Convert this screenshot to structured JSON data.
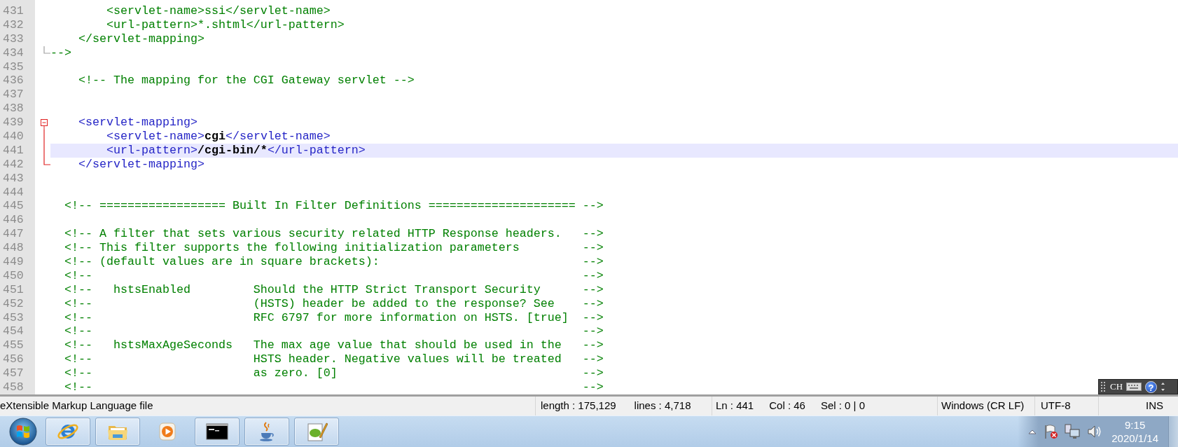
{
  "editor": {
    "lines": [
      {
        "number": "431",
        "kind": "plain",
        "current": false,
        "segments": [
          {
            "kind": "comment",
            "text": "        <servlet-name>ssi</servlet-name>"
          }
        ]
      },
      {
        "number": "432",
        "kind": "plain",
        "current": false,
        "segments": [
          {
            "kind": "comment",
            "text": "        <url-pattern>*.shtml</url-pattern>"
          }
        ]
      },
      {
        "number": "433",
        "kind": "plain",
        "current": false,
        "segments": [
          {
            "kind": "comment",
            "text": "    </servlet-mapping>"
          }
        ]
      },
      {
        "number": "434",
        "kind": "fold_end",
        "current": false,
        "fold_active": false,
        "segments": [
          {
            "kind": "comment",
            "text": "-->"
          }
        ]
      },
      {
        "number": "435",
        "kind": "plain",
        "current": false
      },
      {
        "number": "436",
        "kind": "plain",
        "current": false,
        "segments": [
          {
            "kind": "comment",
            "text": "    <!-- The mapping for the CGI Gateway servlet -->"
          }
        ]
      },
      {
        "number": "437",
        "kind": "plain",
        "current": false
      },
      {
        "number": "438",
        "kind": "plain",
        "current": false
      },
      {
        "number": "439",
        "kind": "fold_start",
        "current": false,
        "fold_active": true,
        "segments": [
          {
            "kind": "tag",
            "text": "    <servlet-mapping>"
          }
        ]
      },
      {
        "number": "440",
        "kind": "fold_line",
        "current": false,
        "fold_active": true,
        "segments": [
          {
            "kind": "tag",
            "text": "        <servlet-name>"
          },
          {
            "kind": "text",
            "text": "cgi"
          },
          {
            "kind": "tag",
            "text": "</servlet-name>"
          }
        ]
      },
      {
        "number": "441",
        "kind": "fold_line",
        "current": true,
        "fold_active": true,
        "segments": [
          {
            "kind": "tag",
            "text": "        <url-pattern>"
          },
          {
            "kind": "text",
            "text": "/cgi-bin/*"
          },
          {
            "kind": "tag",
            "text": "</url-pattern>"
          }
        ]
      },
      {
        "number": "442",
        "kind": "fold_end",
        "current": false,
        "fold_active": true,
        "segments": [
          {
            "kind": "tag",
            "text": "    </servlet-mapping>"
          }
        ]
      },
      {
        "number": "443",
        "kind": "plain",
        "current": false
      },
      {
        "number": "444",
        "kind": "plain",
        "current": false
      },
      {
        "number": "445",
        "kind": "plain",
        "current": false,
        "segments": [
          {
            "kind": "comment",
            "text": "  <!-- ================== Built In Filter Definitions ===================== -->"
          }
        ]
      },
      {
        "number": "446",
        "kind": "plain",
        "current": false
      },
      {
        "number": "447",
        "kind": "plain",
        "current": false,
        "segments": [
          {
            "kind": "comment",
            "text": "  <!-- A filter that sets various security related HTTP Response headers.   -->"
          }
        ]
      },
      {
        "number": "448",
        "kind": "plain",
        "current": false,
        "segments": [
          {
            "kind": "comment",
            "text": "  <!-- This filter supports the following initialization parameters         -->"
          }
        ]
      },
      {
        "number": "449",
        "kind": "plain",
        "current": false,
        "segments": [
          {
            "kind": "comment",
            "text": "  <!-- (default values are in square brackets):                             -->"
          }
        ]
      },
      {
        "number": "450",
        "kind": "plain",
        "current": false,
        "segments": [
          {
            "kind": "comment",
            "text": "  <!--                                                                      -->"
          }
        ]
      },
      {
        "number": "451",
        "kind": "plain",
        "current": false,
        "segments": [
          {
            "kind": "comment",
            "text": "  <!--   hstsEnabled         Should the HTTP Strict Transport Security      -->"
          }
        ]
      },
      {
        "number": "452",
        "kind": "plain",
        "current": false,
        "segments": [
          {
            "kind": "comment",
            "text": "  <!--                       (HSTS) header be added to the response? See    -->"
          }
        ]
      },
      {
        "number": "453",
        "kind": "plain",
        "current": false,
        "segments": [
          {
            "kind": "comment",
            "text": "  <!--                       RFC 6797 for more information on HSTS. [true]  -->"
          }
        ]
      },
      {
        "number": "454",
        "kind": "plain",
        "current": false,
        "segments": [
          {
            "kind": "comment",
            "text": "  <!--                                                                      -->"
          }
        ]
      },
      {
        "number": "455",
        "kind": "plain",
        "current": false,
        "segments": [
          {
            "kind": "comment",
            "text": "  <!--   hstsMaxAgeSeconds   The max age value that should be used in the   -->"
          }
        ]
      },
      {
        "number": "456",
        "kind": "plain",
        "current": false,
        "segments": [
          {
            "kind": "comment",
            "text": "  <!--                       HSTS header. Negative values will be treated   -->"
          }
        ]
      },
      {
        "number": "457",
        "kind": "plain",
        "current": false,
        "segments": [
          {
            "kind": "comment",
            "text": "  <!--                       as zero. [0]                                   -->"
          }
        ]
      },
      {
        "number": "458",
        "kind": "plain",
        "current": false,
        "segments": [
          {
            "kind": "comment",
            "text": "  <!--                                                                      -->"
          }
        ]
      }
    ]
  },
  "language_bar": {
    "label": "CH",
    "help": "?"
  },
  "status_bar": {
    "file_type": "eXtensible Markup Language file",
    "length": "length : 175,129",
    "lines": "lines : 4,718",
    "ln": "Ln : 441",
    "col": "Col : 46",
    "sel": "Sel : 0 | 0",
    "eol": "Windows (CR LF)",
    "encoding": "UTF-8",
    "mode": "INS"
  },
  "taskbar": {
    "buttons": [
      {
        "kind": "browser",
        "running": true
      },
      {
        "kind": "folder",
        "running": true
      },
      {
        "kind": "media",
        "running": false
      },
      {
        "kind": "terminal",
        "running": true
      },
      {
        "kind": "java",
        "running": true
      },
      {
        "kind": "notepad",
        "running": true
      }
    ]
  },
  "clock": {
    "time": "9:15",
    "date": "2020/1/14"
  }
}
